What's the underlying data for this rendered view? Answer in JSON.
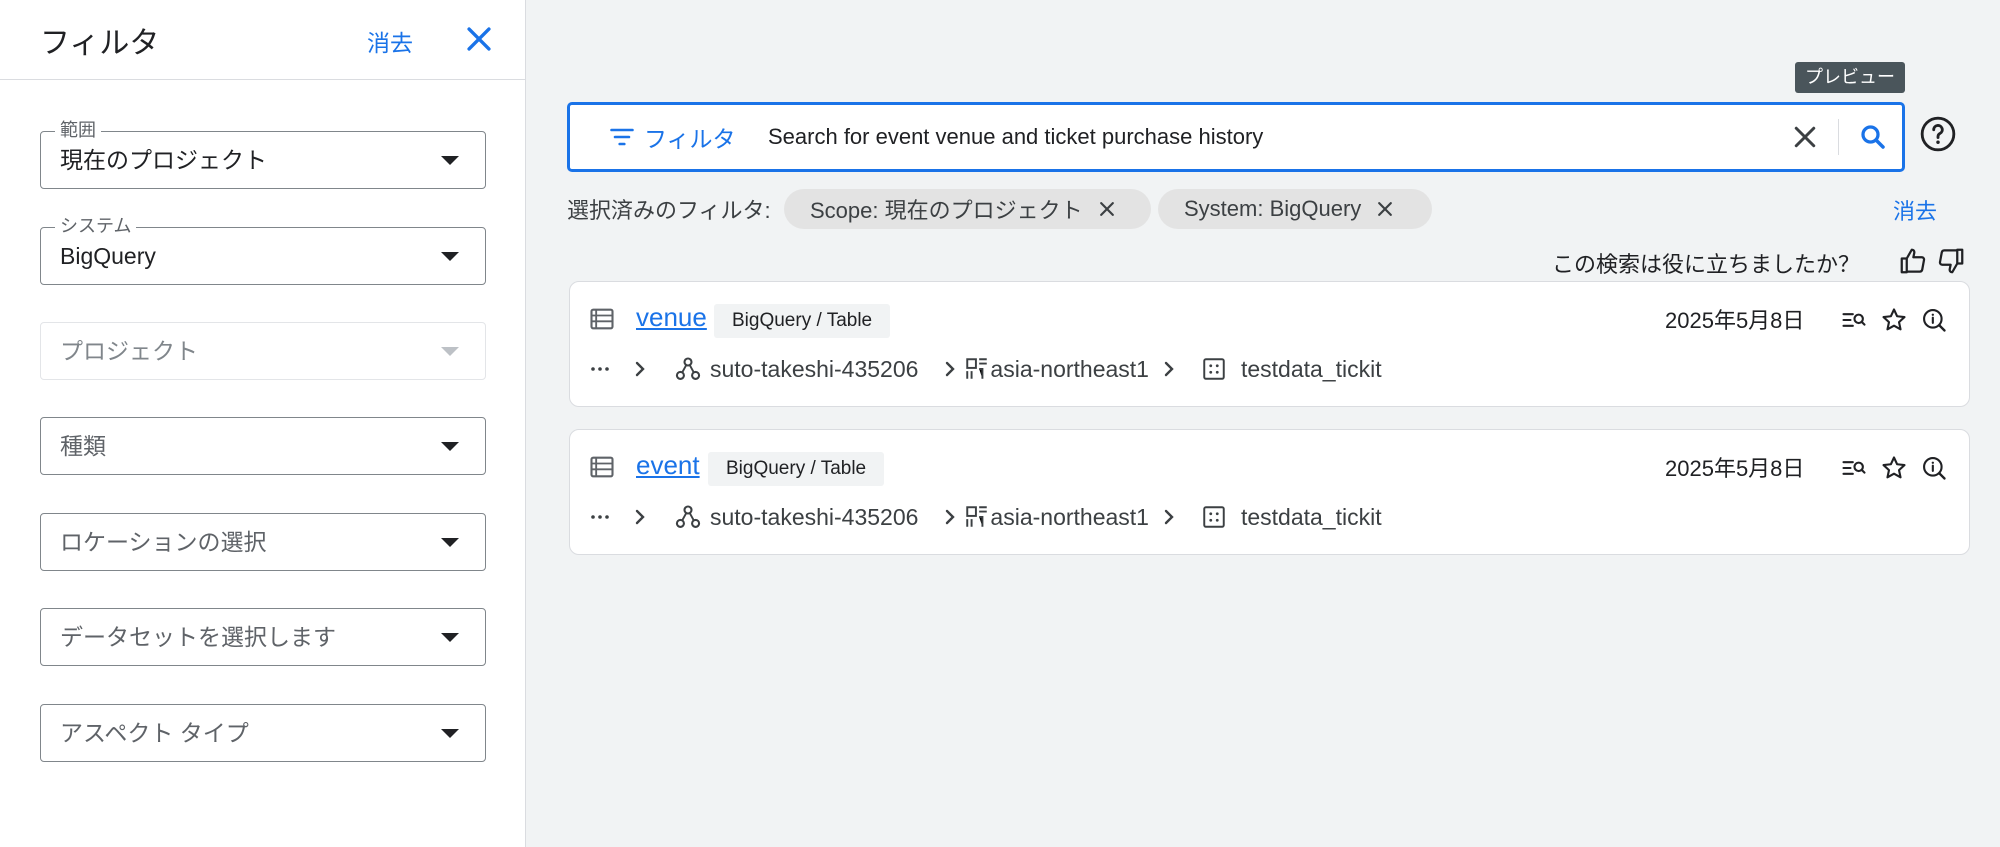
{
  "filter_panel": {
    "title": "フィルタ",
    "clear_label": "消去",
    "fields": [
      {
        "label": "範囲",
        "value": "現在のプロジェクト"
      },
      {
        "label": "システム",
        "value": "BigQuery"
      },
      {
        "placeholder": "プロジェクト",
        "disabled": true
      },
      {
        "placeholder": "種類"
      },
      {
        "placeholder": "ロケーションの選択"
      },
      {
        "placeholder": "データセットを選択します"
      },
      {
        "placeholder": "アスペクト タイプ"
      }
    ]
  },
  "tooltip": "プレビュー",
  "search": {
    "filter_label": "フィルタ",
    "query": "Search for event venue and ticket purchase history"
  },
  "selected_filters": {
    "label": "選択済みのフィルタ:",
    "chips": [
      "Scope: 現在のプロジェクト",
      "System: BigQuery"
    ],
    "clear_label": "消去"
  },
  "feedback": {
    "question": "この検索は役に立ちましたか？"
  },
  "results": [
    {
      "title": "venue",
      "type": "BigQuery / Table",
      "date": "2025年5月8日",
      "breadcrumb": {
        "project": "suto-takeshi-435206",
        "location": "asia-northeast1",
        "dataset": "testdata_tickit"
      }
    },
    {
      "title": "event",
      "type": "BigQuery / Table",
      "date": "2025年5月8日",
      "breadcrumb": {
        "project": "suto-takeshi-435206",
        "location": "asia-northeast1",
        "dataset": "testdata_tickit"
      }
    }
  ],
  "colors": {
    "accent": "#1a73e8",
    "background": "#f1f3f4",
    "chip": "#e3e3e3",
    "tooltip": "#4a555b"
  }
}
